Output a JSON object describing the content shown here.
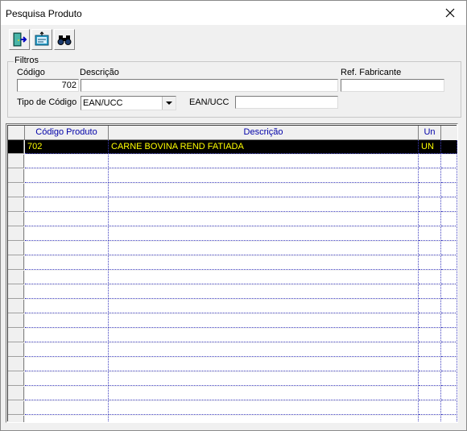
{
  "window": {
    "title": "Pesquisa Produto"
  },
  "toolbar": {
    "buttons": [
      {
        "icon": "exit-door-icon"
      },
      {
        "icon": "clear-form-icon"
      },
      {
        "icon": "binoculars-icon"
      }
    ]
  },
  "filtros": {
    "group_label": "Filtros",
    "codigo_label": "Código",
    "codigo_value": "702",
    "descricao_label": "Descrição",
    "descricao_value": "",
    "ref_fabricante_label": "Ref. Fabricante",
    "ref_fabricante_value": "",
    "tipo_codigo_label": "Tipo de Código",
    "tipo_codigo_value": "EAN/UCC",
    "ean_label": "EAN/UCC",
    "ean_value": ""
  },
  "grid": {
    "columns": [
      "Código Produto",
      "Descrição",
      "Un"
    ],
    "rows": [
      {
        "codigo": "702",
        "descricao": "CARNE BOVINA REND FATIADA",
        "un": "UN"
      }
    ],
    "empty_row_count": 19
  },
  "colors": {
    "header_text": "#0000a8",
    "selected_bg": "#000000",
    "selected_text": "#ffff00"
  }
}
